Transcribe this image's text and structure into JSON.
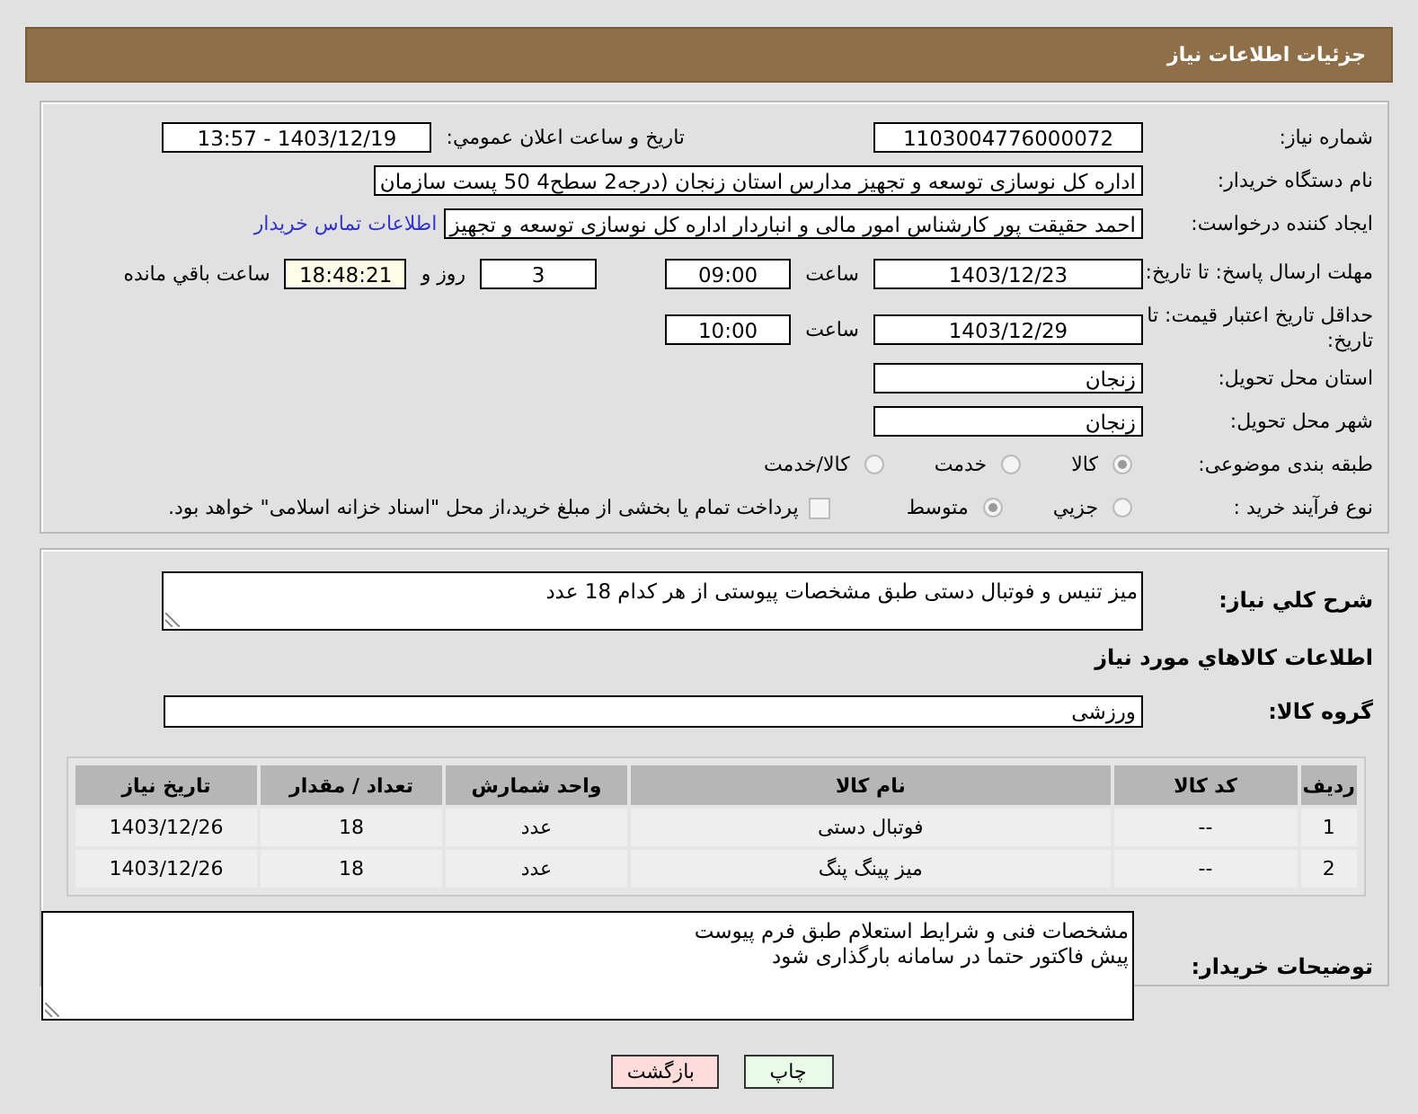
{
  "header": {
    "title": "جزئیات اطلاعات نیاز"
  },
  "need_number": {
    "label": "شماره نیاز:",
    "value": "1103004776000072"
  },
  "announce": {
    "label": "تاریخ و ساعت اعلان عمومي:",
    "value": "1403/12/19 - 13:57"
  },
  "buyer": {
    "label": "نام دستگاه خریدار:",
    "value": "اداره کل نوسازی   توسعه و تجهیز مدارس استان زنجان (درجه2  سطح4  50 پست سازمان"
  },
  "creator": {
    "label": "ایجاد کننده درخواست:",
    "value": "احمد حقیقت پور کارشناس امور مالی و انباردار اداره کل نوسازی   توسعه و تجهیز",
    "link": "اطلاعات تماس خریدار"
  },
  "deadline": {
    "label": "مهلت ارسال پاسخ: تا تاریخ:",
    "date": "1403/12/23",
    "time_label": "ساعت",
    "time": "09:00",
    "days": "3",
    "days_label": "روز و",
    "remaining": "18:48:21",
    "remaining_label": "ساعت باقي مانده"
  },
  "validity": {
    "label": "حداقل تاریخ اعتبار قیمت: تا تاریخ:",
    "date": "1403/12/29",
    "time_label": "ساعت",
    "time": "10:00"
  },
  "province": {
    "label": "استان محل تحویل:",
    "value": "زنجان"
  },
  "city": {
    "label": "شهر محل تحویل:",
    "value": "زنجان"
  },
  "category": {
    "label": "طبقه بندی موضوعی:",
    "options": [
      {
        "label": "کالا",
        "selected": true
      },
      {
        "label": "خدمت",
        "selected": false
      },
      {
        "label": "کالا/خدمت",
        "selected": false
      }
    ]
  },
  "process": {
    "label": "نوع فرآیند خرید :",
    "options": [
      {
        "label": "جزیي",
        "selected": false
      },
      {
        "label": "متوسط",
        "selected": true
      }
    ],
    "payment": {
      "label": "پرداخت تمام یا بخشی از مبلغ خرید،از محل \"اسناد خزانه اسلامی\" خواهد بود.",
      "checked": false
    }
  },
  "description": {
    "label": "شرح کلي نياز:",
    "value": "میز تنیس و فوتبال دستی طبق مشخصات پیوستی از هر کدام 18 عدد"
  },
  "goods_heading": "اطلاعات کالاهاي مورد نياز",
  "goods_group": {
    "label": "گروه کالا:",
    "value": "ورزشی"
  },
  "table": {
    "columns": [
      "ردیف",
      "کد کالا",
      "نام کالا",
      "واحد شمارش",
      "تعداد / مقدار",
      "تاریخ نیاز"
    ],
    "rows": [
      [
        "1",
        "--",
        "فوتبال دستی",
        "عدد",
        "18",
        "1403/12/26"
      ],
      [
        "2",
        "--",
        "میز پینگ پنگ",
        "عدد",
        "18",
        "1403/12/26"
      ]
    ]
  },
  "buyer_notes": {
    "label": "توضیحات خریدار:",
    "lines": [
      "مشخصات فنی و شرایط استعلام طبق فرم پیوست",
      "پیش فاکتور حتما در سامانه بارگذاری شود"
    ]
  },
  "buttons": [
    {
      "label": "چاپ",
      "kind": "print"
    },
    {
      "label": "بازگشت",
      "kind": "back"
    }
  ]
}
